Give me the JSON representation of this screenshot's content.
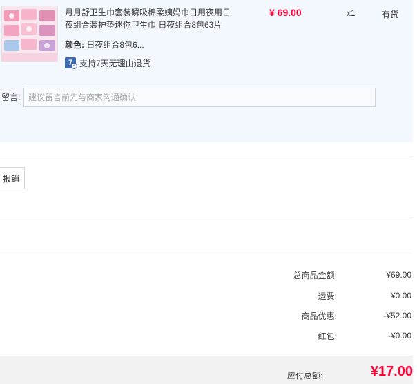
{
  "product": {
    "title": "月月舒卫生巾套装瞬吸棉柔姨妈巾日用夜用日夜组合装护垫迷你卫生巾 日夜组合8包63片",
    "attr_key": "颜色:",
    "attr_value": "日夜组合8包6...",
    "return_policy": "支持7天无理由退货",
    "return_badge": "7",
    "price": "¥ 69.00",
    "quantity": "x1",
    "stock": "有货",
    "thumb_brand": "月月舒",
    "colors": {
      "price": "#ff0036",
      "badge": "#3f6bb4",
      "panel": "#f3f8fe"
    }
  },
  "message": {
    "label": "留言:",
    "placeholder": "建议留言前先与商家沟通确认"
  },
  "invoice": {
    "label": "报销"
  },
  "summary": {
    "rows": [
      {
        "label": "总商品金额:",
        "value": "¥69.00"
      },
      {
        "label": "运费:",
        "value": "¥0.00"
      },
      {
        "label": "商品优惠:",
        "value": "-¥52.00"
      },
      {
        "label": "红包:",
        "value": "-¥0.00"
      }
    ],
    "total_label": "应付总额:",
    "total_value": "¥17.00"
  }
}
